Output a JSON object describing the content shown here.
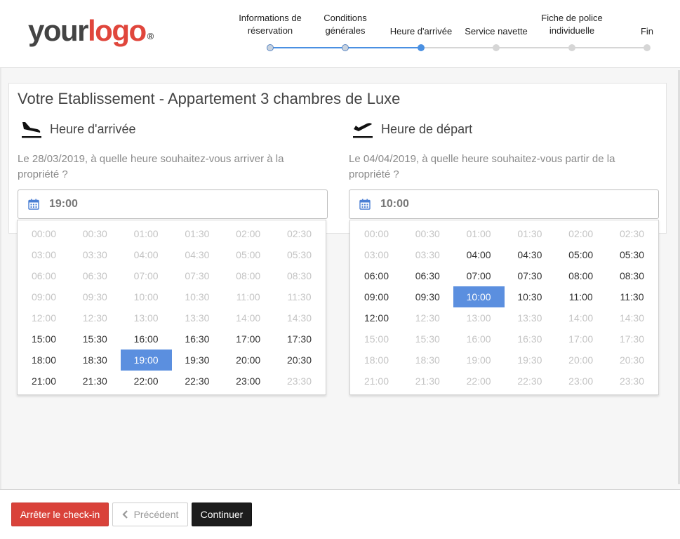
{
  "logo": {
    "part1": "your",
    "part2": "logo",
    "mark": "®"
  },
  "steps": [
    {
      "label": "Informations de réservation",
      "state": "done"
    },
    {
      "label": "Conditions générales",
      "state": "done"
    },
    {
      "label": "Heure d'arrivée",
      "state": "active"
    },
    {
      "label": "Service navette",
      "state": "todo"
    },
    {
      "label": "Fiche de police individuelle",
      "state": "todo"
    },
    {
      "label": "Fin",
      "state": "todo"
    }
  ],
  "title": "Votre Etablissement - Appartement 3 chambres de Luxe",
  "arrival": {
    "heading": "Heure d'arrivée",
    "icon": "plane-landing-icon",
    "question": "Le 28/03/2019, à quelle heure souhaitez-vous arriver à la propriété ?",
    "value": "19:00",
    "times": [
      "00:00",
      "00:30",
      "01:00",
      "01:30",
      "02:00",
      "02:30",
      "03:00",
      "03:30",
      "04:00",
      "04:30",
      "05:00",
      "05:30",
      "06:00",
      "06:30",
      "07:00",
      "07:30",
      "08:00",
      "08:30",
      "09:00",
      "09:30",
      "10:00",
      "10:30",
      "11:00",
      "11:30",
      "12:00",
      "12:30",
      "13:00",
      "13:30",
      "14:00",
      "14:30",
      "15:00",
      "15:30",
      "16:00",
      "16:30",
      "17:00",
      "17:30",
      "18:00",
      "18:30",
      "19:00",
      "19:30",
      "20:00",
      "20:30",
      "21:00",
      "21:30",
      "22:00",
      "22:30",
      "23:00",
      "23:30"
    ],
    "enabled": [
      "15:00",
      "15:30",
      "16:00",
      "16:30",
      "17:00",
      "17:30",
      "18:00",
      "18:30",
      "19:00",
      "19:30",
      "20:00",
      "20:30",
      "21:00",
      "21:30",
      "22:00",
      "22:30",
      "23:00"
    ],
    "selected": "19:00"
  },
  "departure": {
    "heading": "Heure de départ",
    "icon": "plane-takeoff-icon",
    "question": "Le 04/04/2019, à quelle heure souhaitez-vous partir de la propriété ?",
    "value": "10:00",
    "times": [
      "00:00",
      "00:30",
      "01:00",
      "01:30",
      "02:00",
      "02:30",
      "03:00",
      "03:30",
      "04:00",
      "04:30",
      "05:00",
      "05:30",
      "06:00",
      "06:30",
      "07:00",
      "07:30",
      "08:00",
      "08:30",
      "09:00",
      "09:30",
      "10:00",
      "10:30",
      "11:00",
      "11:30",
      "12:00",
      "12:30",
      "13:00",
      "13:30",
      "14:00",
      "14:30",
      "15:00",
      "15:30",
      "16:00",
      "16:30",
      "17:00",
      "17:30",
      "18:00",
      "18:30",
      "19:00",
      "19:30",
      "20:00",
      "20:30",
      "21:00",
      "21:30",
      "22:00",
      "22:30",
      "23:00",
      "23:30"
    ],
    "enabled": [
      "04:00",
      "04:30",
      "05:00",
      "05:30",
      "06:00",
      "06:30",
      "07:00",
      "07:30",
      "08:00",
      "08:30",
      "09:00",
      "09:30",
      "10:00",
      "10:30",
      "11:00",
      "11:30",
      "12:00"
    ],
    "selected": "10:00"
  },
  "footer": {
    "stop_label": "Arrêter le check-in",
    "prev_label": "Précédent",
    "next_label": "Continuer"
  },
  "colors": {
    "accent": "#4a90e2",
    "selected": "#5b8fdf",
    "danger": "#d9423a",
    "dark": "#1d1d1d"
  }
}
